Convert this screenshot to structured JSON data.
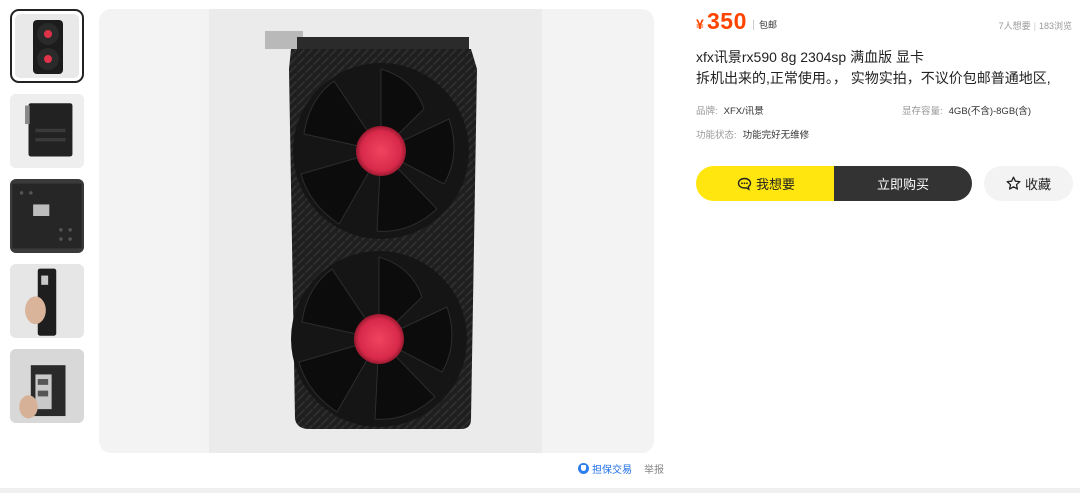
{
  "thumbnails": [
    {
      "name": "thumb-front-fans",
      "active": true
    },
    {
      "name": "thumb-side-view",
      "active": false
    },
    {
      "name": "thumb-backplate",
      "active": false
    },
    {
      "name": "thumb-held-in-hand",
      "active": false
    },
    {
      "name": "thumb-io-bracket",
      "active": false
    }
  ],
  "image_actions": {
    "guarantee": "担保交易",
    "report": "举报"
  },
  "price": {
    "currency": "¥",
    "amount": "350",
    "shipping": "包邮",
    "color": "#ff4400"
  },
  "stats": {
    "wants": "7人想要",
    "views": "183浏览"
  },
  "listing": {
    "title": "xfx讯景rx590 8g 2304sp 满血版 显卡",
    "description": "拆机出来的,正常使用。，  实物实拍，不议价包邮普通地区,"
  },
  "attributes": {
    "brand_label": "品牌:",
    "brand_value": "XFX/讯景",
    "memory_label": "显存容量:",
    "memory_value": "4GB(不含)-8GB(含)",
    "condition_label": "功能状态:",
    "condition_value": "功能完好无维修"
  },
  "actions": {
    "want_label": "我想要",
    "buy_label": "立即购买",
    "favorite_label": "收藏",
    "want_color": "#ffe60f",
    "buy_color": "#333333"
  }
}
